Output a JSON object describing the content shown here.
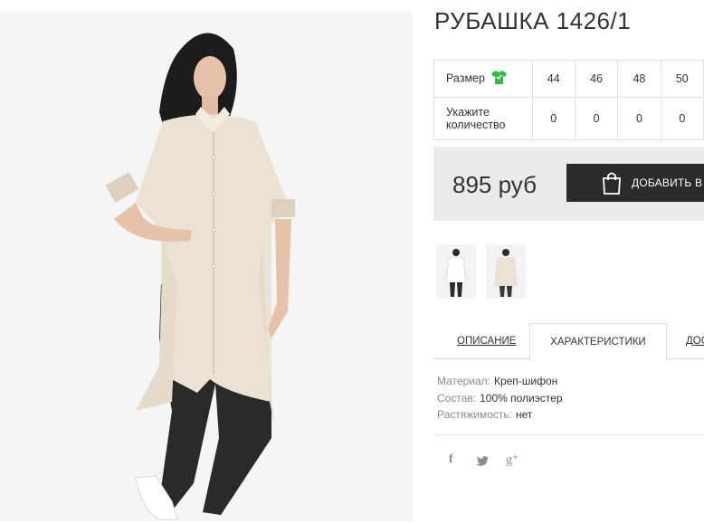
{
  "product": {
    "title": "РУБАШКА 1426/1"
  },
  "sizes": {
    "size_label": "Размер",
    "qty_label_line1": "Укажите",
    "qty_label_line2": "количество",
    "values": [
      "44",
      "46",
      "48",
      "50"
    ],
    "quantities": [
      "0",
      "0",
      "0",
      "0"
    ],
    "icon": "shirt-icon",
    "icon_color": "#2fbf3f"
  },
  "purchase": {
    "price": "895 руб",
    "button_label": "ДОБАВИТЬ В З",
    "button_icon": "shopping-bag-icon"
  },
  "tabs": [
    {
      "label": "ОПИСАНИЕ"
    },
    {
      "label": "ХАРАКТЕРИСТИКИ",
      "active": true
    },
    {
      "label": "ДОС"
    }
  ],
  "characteristics": [
    {
      "key": "Материал:",
      "value": "Креп-шифон"
    },
    {
      "key": "Состав:",
      "value": "100% полиэстер"
    },
    {
      "key": "Растяжимость:",
      "value": "нет"
    }
  ],
  "social": {
    "facebook": "f",
    "googleplus": "g⁺",
    "icons": [
      "facebook-icon",
      "twitter-icon",
      "google-plus-icon"
    ]
  }
}
